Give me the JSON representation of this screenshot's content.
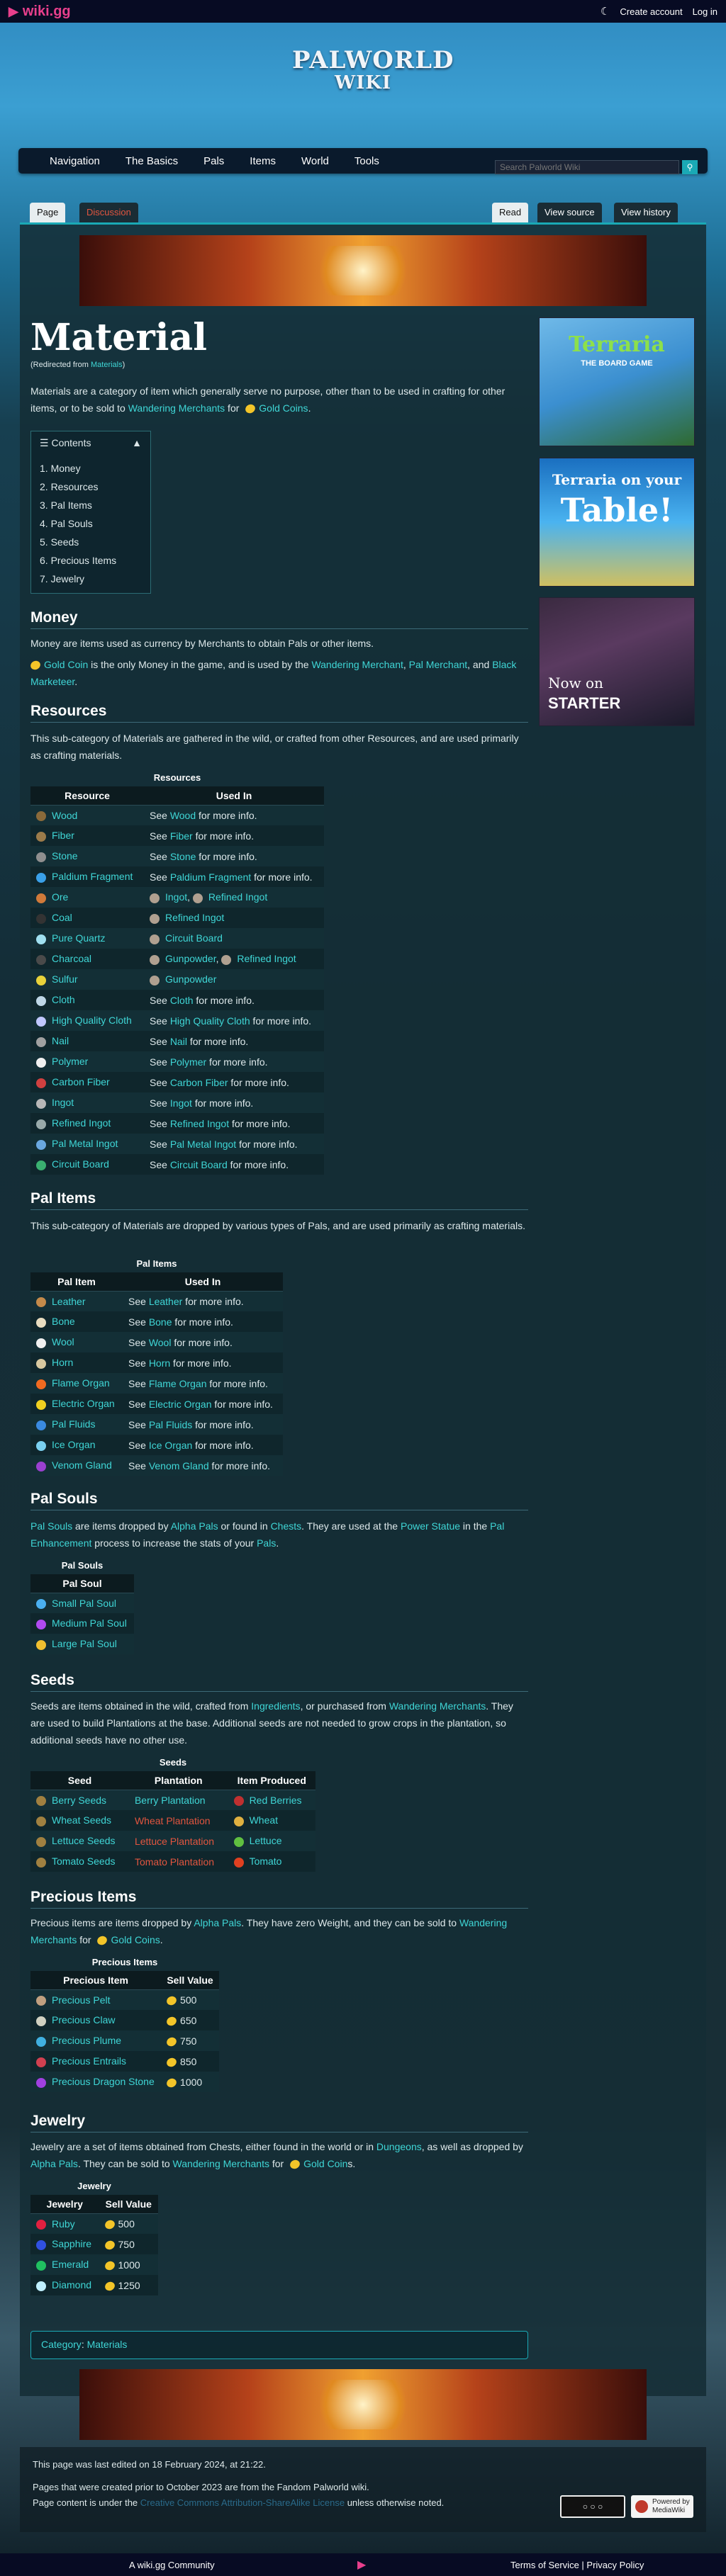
{
  "topbar": {
    "logo": "wiki.gg",
    "create_account": "Create account",
    "login": "Log in"
  },
  "brand": {
    "line1": "PALWORLD",
    "line2": "WIKI"
  },
  "nav": [
    "Navigation",
    "The Basics",
    "Pals",
    "Items",
    "World",
    "Tools"
  ],
  "search": {
    "placeholder": "Search Palworld Wiki"
  },
  "tabs": {
    "page": "Page",
    "discussion": "Discussion",
    "read": "Read",
    "view_source": "View source",
    "view_history": "View history"
  },
  "article": {
    "title": "Material",
    "redirect_prefix": "(Redirected from ",
    "redirect_link": "Materials",
    "redirect_suffix": ")",
    "intro": {
      "a": "Materials are a category of item which generally serve no purpose, other than to be used in crafting for other items, or to be sold to ",
      "link1": "Wandering Merchants",
      "b": " for ",
      "link2": "Gold Coins",
      "c": "."
    }
  },
  "toc": {
    "heading": "Contents",
    "items": [
      "1. Money",
      "2. Resources",
      "3. Pal Items",
      "4. Pal Souls",
      "5. Seeds",
      "6. Precious Items",
      "7. Jewelry"
    ]
  },
  "money": {
    "heading": "Money",
    "p1": "Money are items used as currency by Merchants to obtain Pals or other items.",
    "p2": {
      "link1": "Gold Coin",
      "a": " is the only Money in the game, and is used by the ",
      "link2": "Wandering Merchant",
      "b": ", ",
      "link3": "Pal Merchant",
      "c": ", and ",
      "link4": "Black Marketeer",
      "d": "."
    }
  },
  "resources": {
    "heading": "Resources",
    "desc": "This sub-category of Materials are gathered in the wild, or crafted from other Resources, and are used primarily as crafting materials.",
    "caption": "Resources",
    "headers": [
      "Resource",
      "Used In"
    ],
    "rows": [
      {
        "name": "Wood",
        "used": "Wood",
        "color": "#8a6a3a"
      },
      {
        "name": "Fiber",
        "used": "Fiber",
        "color": "#9c7b4a"
      },
      {
        "name": "Stone",
        "used": "Stone",
        "color": "#8f8f8f"
      },
      {
        "name": "Paldium Fragment",
        "used": "Paldium Fragment",
        "color": "#3aa0e8"
      },
      {
        "name": "Ore",
        "used2": [
          "Ingot",
          "Refined Ingot"
        ],
        "color": "#d07a3a"
      },
      {
        "name": "Coal",
        "used2": [
          "Refined Ingot"
        ],
        "color": "#333"
      },
      {
        "name": "Pure Quartz",
        "used2": [
          "Circuit Board"
        ],
        "color": "#a0e0f0"
      },
      {
        "name": "Charcoal",
        "used2": [
          "Gunpowder",
          "Refined Ingot"
        ],
        "color": "#4a4a4a"
      },
      {
        "name": "Sulfur",
        "used2": [
          "Gunpowder"
        ],
        "color": "#e8d23a"
      },
      {
        "name": "Cloth",
        "used": "Cloth",
        "color": "#bfd6e6"
      },
      {
        "name": "High Quality Cloth",
        "used": "High Quality Cloth",
        "color": "#c0c8ff"
      },
      {
        "name": "Nail",
        "used": "Nail",
        "color": "#a0a0a0"
      },
      {
        "name": "Polymer",
        "used": "Polymer",
        "color": "#f0f0f0"
      },
      {
        "name": "Carbon Fiber",
        "used": "Carbon Fiber",
        "color": "#d04040"
      },
      {
        "name": "Ingot",
        "used": "Ingot",
        "color": "#b8b8b8"
      },
      {
        "name": "Refined Ingot",
        "used": "Refined Ingot",
        "color": "#9aa"
      },
      {
        "name": "Pal Metal Ingot",
        "used": "Pal Metal Ingot",
        "color": "#6aa8e0"
      },
      {
        "name": "Circuit Board",
        "used": "Circuit Board",
        "color": "#3ab070"
      }
    ]
  },
  "see": "See ",
  "more": " for more info.",
  "palitems": {
    "heading": "Pal Items",
    "desc": "This sub-category of Materials are dropped by various types of Pals, and are used primarily as crafting materials.",
    "caption": "Pal Items",
    "headers": [
      "Pal Item",
      "Used In"
    ],
    "rows": [
      {
        "name": "Leather",
        "color": "#c48a4a"
      },
      {
        "name": "Bone",
        "color": "#e8dcc0"
      },
      {
        "name": "Wool",
        "color": "#f0f0f0"
      },
      {
        "name": "Horn",
        "color": "#d8c8a0"
      },
      {
        "name": "Flame Organ",
        "color": "#f06a20"
      },
      {
        "name": "Electric Organ",
        "color": "#f0d020"
      },
      {
        "name": "Pal Fluids",
        "color": "#3a8ae0"
      },
      {
        "name": "Ice Organ",
        "color": "#7ad0f0"
      },
      {
        "name": "Venom Gland",
        "color": "#9a40d0"
      }
    ]
  },
  "palsouls": {
    "heading": "Pal Souls",
    "desc": {
      "link1": "Pal Souls",
      "a": " are items dropped by ",
      "link2": "Alpha Pals",
      "b": " or found in ",
      "link3": "Chests",
      "c": ". They are used at the ",
      "link4": "Power Statue",
      "d": " in the ",
      "link5": "Pal Enhancement",
      "e": " process to increase the stats of your ",
      "link6": "Pals",
      "f": "."
    },
    "caption": "Pal Souls",
    "headers": [
      "Pal Soul"
    ],
    "rows": [
      {
        "name": "Small Pal Soul",
        "color": "#4ab0f0"
      },
      {
        "name": "Medium Pal Soul",
        "color": "#b04af0"
      },
      {
        "name": "Large Pal Soul",
        "color": "#f0c030"
      }
    ]
  },
  "seeds": {
    "heading": "Seeds",
    "desc": {
      "a": "Seeds are items obtained in the wild, crafted from ",
      "link1": "Ingredients",
      "b": ", or purchased from ",
      "link2": "Wandering Merchants",
      "c": ". They are used to build Plantations at the base. Additional seeds are not needed to grow crops in the plantation, so additional seeds have no other use."
    },
    "caption": "Seeds",
    "headers": [
      "Seed",
      "Plantation",
      "Item Produced"
    ],
    "rows": [
      {
        "seed": "Berry Seeds",
        "plant": "Berry Plantation",
        "plant_red": false,
        "item": "Red Berries",
        "color": "#c03030"
      },
      {
        "seed": "Wheat Seeds",
        "plant": "Wheat Plantation",
        "plant_red": true,
        "item": "Wheat",
        "color": "#e0b040"
      },
      {
        "seed": "Lettuce Seeds",
        "plant": "Lettuce Plantation",
        "plant_red": true,
        "item": "Lettuce",
        "color": "#60c040"
      },
      {
        "seed": "Tomato Seeds",
        "plant": "Tomato Plantation",
        "plant_red": true,
        "item": "Tomato",
        "color": "#e04020"
      }
    ]
  },
  "precious": {
    "heading": "Precious Items",
    "desc": {
      "a": "Precious items are items dropped by ",
      "link1": "Alpha Pals",
      "b": ". They have zero Weight, and they can be sold to ",
      "link2": "Wandering Merchants",
      "c": " for ",
      "link3": "Gold Coins",
      "d": "."
    },
    "caption": "Precious Items",
    "headers": [
      "Precious Item",
      "Sell Value"
    ],
    "rows": [
      {
        "name": "Precious Pelt",
        "value": "500",
        "color": "#c0a080"
      },
      {
        "name": "Precious Claw",
        "value": "650",
        "color": "#d0d0c0"
      },
      {
        "name": "Precious Plume",
        "value": "750",
        "color": "#40b0e0"
      },
      {
        "name": "Precious Entrails",
        "value": "850",
        "color": "#d04050"
      },
      {
        "name": "Precious Dragon Stone",
        "value": "1000",
        "color": "#a040e0"
      }
    ]
  },
  "jewelry": {
    "heading": "Jewelry",
    "desc": {
      "a": "Jewelry are a set of items obtained from Chests, either found in the world or in ",
      "link1": "Dungeons",
      "b": ", as well as dropped by ",
      "link2": "Alpha Pals",
      "c": ". They can be sold to ",
      "link3": "Wandering Merchants",
      "d": " for ",
      "link4": "Gold Coin",
      "e": "s."
    },
    "caption": "Jewelry",
    "headers": [
      "Jewelry",
      "Sell Value"
    ],
    "rows": [
      {
        "name": "Ruby",
        "value": "500",
        "color": "#e02040"
      },
      {
        "name": "Sapphire",
        "value": "750",
        "color": "#3050e0"
      },
      {
        "name": "Emerald",
        "value": "1000",
        "color": "#20c060"
      },
      {
        "name": "Diamond",
        "value": "1250",
        "color": "#c0f0ff"
      }
    ]
  },
  "category": {
    "label": "Category",
    "sep": ": ",
    "link": "Materials"
  },
  "footer": {
    "edited": "This page was last edited on 18 February 2024, at 21:22.",
    "fandom": "Pages that were created prior to October 2023 are from the Fandom Palworld wiki.",
    "license_a": "Page content is under the ",
    "license_link": "Creative Commons Attribution-ShareAlike License",
    "license_b": " unless otherwise noted.",
    "mw": "Powered by MediaWiki"
  },
  "bottom": {
    "community": "A wiki.gg Community",
    "terms": "Terms of Service",
    "sep": " | ",
    "privacy": "Privacy Policy"
  },
  "ads": {
    "ad1_top": "Terraria",
    "ad1_sub": "THE BOARD GAME",
    "ad2_line1": "Terraria on your",
    "ad2_line2": "Table!",
    "ad3_line1": "Now on",
    "ad3_line2": "STARTER"
  }
}
